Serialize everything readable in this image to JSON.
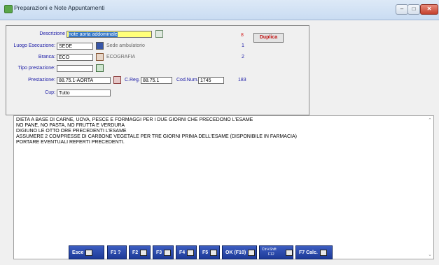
{
  "window": {
    "title": "Preparazioni e Note Appuntamenti",
    "min": "–",
    "max": "□",
    "close": "✕"
  },
  "form": {
    "descrizione": {
      "label": "Descrizione",
      "value": "note aorta addominale",
      "count": "8",
      "duplica": "Duplica"
    },
    "luogo": {
      "label": "Luogo Esecuzione:",
      "value": "SEDE",
      "desc": "Sede ambulatorio",
      "count": "1"
    },
    "branca": {
      "label": "Branca:",
      "value": "ECO",
      "desc": "ECOGRAFIA",
      "count": "2"
    },
    "tipo": {
      "label": "Tipo prestazione:",
      "value": ""
    },
    "prestazione": {
      "label": "Prestazione:",
      "value": "88.75.1-AORTA",
      "creg_label": "C.Reg.",
      "creg_value": "88.75.1",
      "codnum_label": "Cod.Num.",
      "codnum_value": "1745",
      "count": "183"
    },
    "cup": {
      "label": "Cup:",
      "value": "Tutto"
    }
  },
  "notes": {
    "lines": [
      "DIETA A BASE DI CARNE, UOVA, PESCE E FORMAGGI PER I DUE GIORNI CHE PRECEDONO L'ESAME",
      "NO PANE, NO PASTA, NO FRUTTA E VERDURA",
      "DIGIUNO LE OTTO ORE PRECEDENTI L'ESAME",
      "ASSUMERE 2 COMPRESSE DI CARBONE VEGETALE PER TRE GIORNI PRIMA DELL'ESAME (DISPONIBILE IN FARMACIA)",
      "PORTARE EVENTUALI REFERTI PRECEDENTI."
    ]
  },
  "footer": {
    "esce": "Esce",
    "f1": "F1 ?",
    "f2": "F2",
    "f3": "F3",
    "f4": "F4",
    "f5": "F5",
    "ok": "OK (F10)",
    "ctrl_top": "Ctrl+Shift",
    "ctrl_bottom": "F12",
    "f7": "F7 Calc."
  }
}
